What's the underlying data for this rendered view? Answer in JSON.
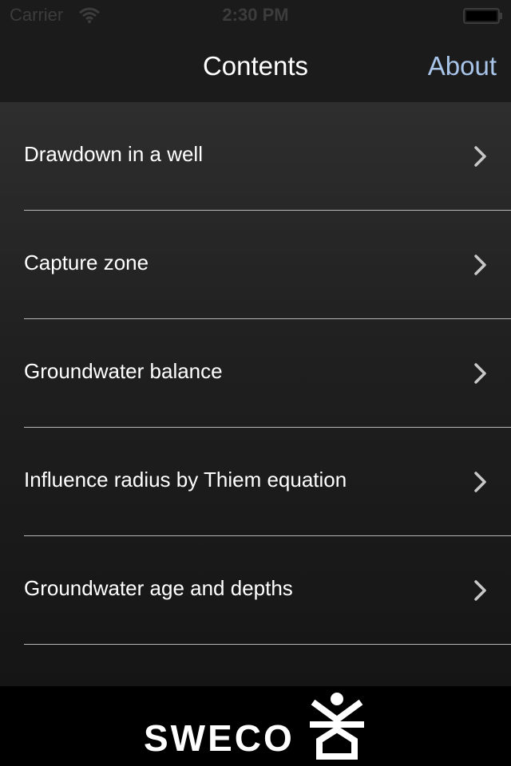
{
  "status_bar": {
    "carrier": "Carrier",
    "time": "2:30 PM"
  },
  "nav": {
    "title": "Contents",
    "about_label": "About"
  },
  "items": [
    {
      "label": "Drawdown in a well"
    },
    {
      "label": "Capture zone"
    },
    {
      "label": "Groundwater balance"
    },
    {
      "label": "Influence radius by Thiem equation"
    },
    {
      "label": "Groundwater age and depths"
    }
  ],
  "footer": {
    "brand": "SWECO"
  },
  "colors": {
    "accent": "#a8c4e8",
    "background": "#141414",
    "bar": "#1b1b1b"
  },
  "icons": {
    "wifi": "wifi-icon",
    "battery": "battery-icon",
    "chevron": "chevron-right-icon",
    "logo": "sweco-logo-icon"
  }
}
